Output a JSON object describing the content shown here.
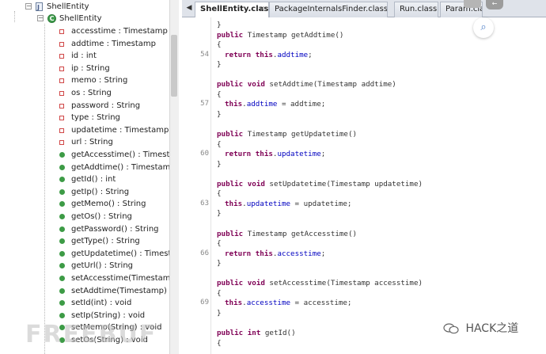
{
  "tree": {
    "file_label": "ShellEntity",
    "class_label": "ShellEntity",
    "members": [
      {
        "kind": "field",
        "label": "accesstime : Timestamp"
      },
      {
        "kind": "field",
        "label": "addtime : Timestamp"
      },
      {
        "kind": "field",
        "label": "id : int"
      },
      {
        "kind": "field",
        "label": "ip : String"
      },
      {
        "kind": "field",
        "label": "memo : String"
      },
      {
        "kind": "field",
        "label": "os : String"
      },
      {
        "kind": "field",
        "label": "password : String"
      },
      {
        "kind": "field",
        "label": "type : String"
      },
      {
        "kind": "field",
        "label": "updatetime : Timestamp"
      },
      {
        "kind": "field",
        "label": "url : String"
      },
      {
        "kind": "method",
        "label": "getAccesstime() : Timestam"
      },
      {
        "kind": "method",
        "label": "getAddtime() : Timestamp"
      },
      {
        "kind": "method",
        "label": "getId() : int"
      },
      {
        "kind": "method",
        "label": "getIp() : String"
      },
      {
        "kind": "method",
        "label": "getMemo() : String"
      },
      {
        "kind": "method",
        "label": "getOs() : String"
      },
      {
        "kind": "method",
        "label": "getPassword() : String"
      },
      {
        "kind": "method",
        "label": "getType() : String"
      },
      {
        "kind": "method",
        "label": "getUpdatetime() : Timestam"
      },
      {
        "kind": "method",
        "label": "getUrl() : String"
      },
      {
        "kind": "method",
        "label": "setAccesstime(Timestamp) :"
      },
      {
        "kind": "method",
        "label": "setAddtime(Timestamp) : vc"
      },
      {
        "kind": "method",
        "label": "setId(int) : void"
      },
      {
        "kind": "method",
        "label": "setIp(String) : void"
      },
      {
        "kind": "method",
        "label": "setMemo(String) : void"
      },
      {
        "kind": "method",
        "label": "setOs(String) : void"
      }
    ]
  },
  "tabs": [
    {
      "label": "ShellEntity.class",
      "active": true,
      "close": "×"
    },
    {
      "label": "PackageInternalsFinder.class",
      "active": false
    },
    {
      "label": "Run.class",
      "active": false
    },
    {
      "label": "Param.class",
      "active": false
    }
  ],
  "tab_arrow": "◀",
  "float_button": "←",
  "code": {
    "line_numbers": [
      "54",
      "57",
      "60",
      "63",
      "66",
      "69"
    ],
    "text": {
      "brace_close": "}",
      "brace_open": "{",
      "public": "public",
      "return": "return",
      "this": "this",
      "void": "void",
      "int": "int",
      "get_addtime": " Timestamp getAddtime()",
      "set_addtime": " setAddtime(Timestamp addtime)",
      "get_updatetime": " Timestamp getUpdatetime()",
      "set_updatetime": " setUpdatetime(Timestamp updatetime)",
      "get_accesstime": " Timestamp getAccesstime()",
      "set_accesstime": " setAccesstime(Timestamp accesstime)",
      "get_id": " getId()",
      "addtime": "addtime",
      "updatetime": "updatetime",
      "accesstime": "accesstime",
      "dot": ".",
      "semi": ";",
      "assign_addtime": " = addtime;",
      "assign_updatetime": " = updatetime;",
      "assign_accesstime": " = accesstime;"
    }
  },
  "watermark_left": "FREEBUF",
  "watermark_right": "HACK之道",
  "colors": {
    "keyword": "#7f0055",
    "field": "#0000c0",
    "tree_method": "#3d9b46",
    "tree_field": "#d04747"
  }
}
